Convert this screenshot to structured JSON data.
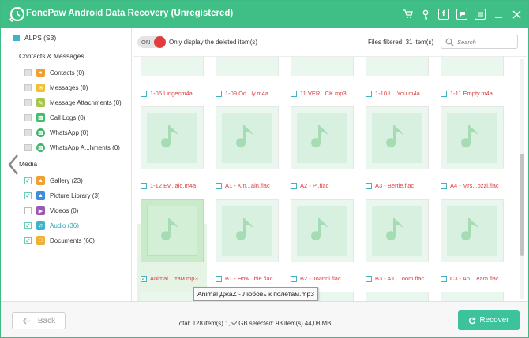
{
  "app": {
    "title": "FonePaw Android Data Recovery (Unregistered)",
    "colors": {
      "accent": "#3fbf85",
      "selected_text": "#2aa5b9",
      "deleted_text": "#e03e3e",
      "recover": "#3dc39b"
    },
    "toolbar_icons": [
      "cart-icon",
      "key-icon",
      "facebook-icon",
      "chat-icon",
      "menu-icon",
      "minimize-icon",
      "close-icon"
    ]
  },
  "sidebar": {
    "device": "ALPS (S3)",
    "sections": [
      {
        "title": "Contacts & Messages",
        "items": [
          {
            "label": "Contacts (0)",
            "icon": "contacts-icon",
            "color": "#f0a030"
          },
          {
            "label": "Messages (0)",
            "icon": "message-icon",
            "color": "#f0c030"
          },
          {
            "label": "Message Attachments (0)",
            "icon": "attachment-icon",
            "color": "#a6c84a"
          },
          {
            "label": "Call Logs (0)",
            "icon": "phone-icon",
            "color": "#3fbf6a"
          },
          {
            "label": "WhatsApp (0)",
            "icon": "whatsapp-icon",
            "color": "#3fb46a"
          },
          {
            "label": "WhatsApp A...hments (0)",
            "icon": "whatsapp-attachment-icon",
            "color": "#3fb46a"
          }
        ]
      },
      {
        "title": "Media",
        "items": [
          {
            "label": "Gallery (23)",
            "icon": "gallery-icon",
            "color": "#f0a030"
          },
          {
            "label": "Picture Library (3)",
            "icon": "picture-icon",
            "color": "#3f8fd8"
          },
          {
            "label": "Videos (0)",
            "icon": "video-icon",
            "color": "#9b59b6"
          },
          {
            "label": "Audio (36)",
            "icon": "audio-icon",
            "color": "#3fb4c8"
          },
          {
            "label": "Documents (66)",
            "icon": "document-icon",
            "color": "#f0b030"
          }
        ]
      }
    ]
  },
  "header": {
    "toggle_label": "ON",
    "only_deleted": "Only display the deleted item(s)",
    "files_filtered": "Files filtered: 31 item(s)",
    "search_placeholder": "Search"
  },
  "files": [
    {
      "name": "1-06 Lingecm4a",
      "checked": false
    },
    {
      "name": "1-09 Od...ly.m4a",
      "checked": false
    },
    {
      "name": "11 VER...CK.mp3",
      "checked": false
    },
    {
      "name": "1-10 I ...You.m4a",
      "checked": false
    },
    {
      "name": "1-11 Empty.m4a",
      "checked": false
    },
    {
      "name": "1-12 Ev...aid.m4a",
      "checked": false
    },
    {
      "name": "A1 - Kin...ain.flac",
      "checked": false
    },
    {
      "name": "A2 - Pi.flac",
      "checked": false
    },
    {
      "name": "A3 - Bertie.flac",
      "checked": false
    },
    {
      "name": "A4 - Mrs...ozzi.flac",
      "checked": false
    },
    {
      "name": "Animal ...там.mp3",
      "checked": true
    },
    {
      "name": "B1 - How...ble.flac",
      "checked": false
    },
    {
      "name": "B2 - Joanni.flac",
      "checked": false
    },
    {
      "name": "B3 - A C...oom.flac",
      "checked": false
    },
    {
      "name": "C3 - An ...eam.flac",
      "checked": false
    }
  ],
  "tooltip": "Animal ДжаZ - Любовь к полетам.mp3",
  "footer": {
    "back_label": "Back",
    "totals": "Total: 128 item(s) 1,52 GB    selected: 93 item(s) 44,08 MB",
    "recover_label": "Recover"
  }
}
